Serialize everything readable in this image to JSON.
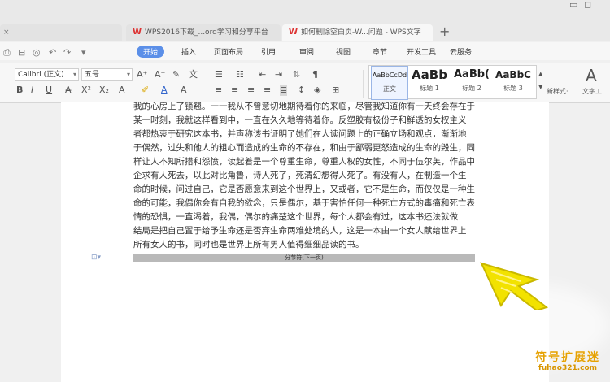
{
  "tabs": [
    {
      "label": "WPS2016下载_...ord学习和分享平台"
    },
    {
      "label": "如何删除空白页-W...问题 - WPS文字"
    }
  ],
  "new_tab": "+",
  "menu": [
    "开始",
    "插入",
    "页面布局",
    "引用",
    "审阅",
    "视图",
    "章节",
    "开发工具",
    "云服务"
  ],
  "font": {
    "name": "Calibri (正文)",
    "size": "五号"
  },
  "styles": [
    {
      "preview": "AaBbCcDd",
      "label": "正文"
    },
    {
      "preview": "AaBb",
      "label": "标题 1"
    },
    {
      "preview": "AaBb(",
      "label": "标题 2"
    },
    {
      "preview": "AaBbC",
      "label": "标题 3"
    }
  ],
  "new_style": "新样式·",
  "text_tools": "文字工",
  "doc_lines": [
    "我的心房上了锁翘。一一我从不曾意切地期待着你的来临，尽管我知道你有一天终会存在于",
    "某一时刻，我就这样看到中，一直在久久地等待着你。反塑胶有极份子和鲜透的女权主义",
    "者都热衷于研究这本书，并声称该书证明了她们在人读问题上的正确立场和观点，渐渐地",
    "于偶然，过失和他人的粗心而造成的生命的不存在，和由于鄙弱更怒造成的生命的毁生，同",
    "样让人不知所措和怨愤，读起着是一个尊重生命，尊重人权的女性，不同于伍尔芙，作品中",
    "企求有人死去，以此对比角鲁，诗人死了，死清幻想得人死了。有没有人，在制造一个生",
    "命的时候，问过自己，它是否愿意来到这个世界上，又或者，它不是生命，而仅仅是一种生",
    "命的可能，我偶你会有自我的欲念，只是偶尔，基于害怕任何一种死亡方式的毒痛和死亡表",
    "情的恐惧，一直渴着，我偶，偶尔的痛楚这个世界，每个人都会有过，这本书还法就做",
    "结局是把自己置于给予生命还是否弃生命两难处境的人，这是一本由一个女人献给世界上",
    "所有女人的书，同时也是世界上所有男人值得细细品读的书。"
  ],
  "section_break": "分节符(下一页)",
  "watermark": {
    "line1": "符号扩展迷",
    "line2": "fuhao321.com"
  },
  "colors": {
    "accent": "#5b8fe8",
    "brand_red": "#d33",
    "cursor": "#f2e200",
    "watermark": "#e6a100"
  }
}
